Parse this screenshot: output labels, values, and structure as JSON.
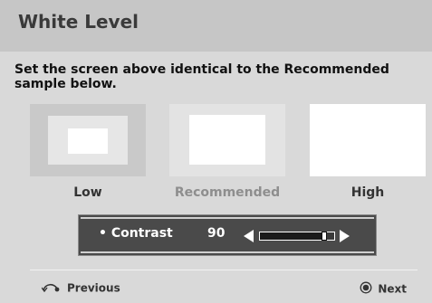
{
  "header": {
    "title": "White Level"
  },
  "instructions": "Set the screen above identical to the Recommended sample  below.",
  "samples": [
    {
      "label": "Low"
    },
    {
      "label": "Recommended"
    },
    {
      "label": "High"
    }
  ],
  "contrast": {
    "label": "• Contrast",
    "value": "90",
    "level": 0.9
  },
  "footer": {
    "previous_label": "Previous",
    "next_label": "Next",
    "previous_icon": "return-icon",
    "next_icon": "enter-icon"
  },
  "colors": {
    "header_bg": "#c6c6c6",
    "page_bg": "#d9d9d9",
    "contrast_bg": "#4a4a4a",
    "recommended_label": "#8e8e8e"
  }
}
